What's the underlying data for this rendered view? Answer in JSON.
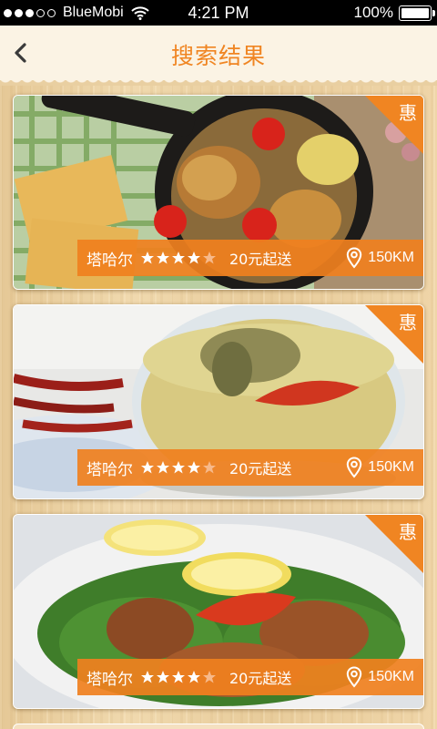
{
  "status_bar": {
    "carrier": "BlueMobi",
    "time": "4:21 PM",
    "battery": "100%"
  },
  "nav": {
    "title": "搜索结果",
    "back_icon": "chevron-left-icon"
  },
  "colors": {
    "accent": "#f08522",
    "nav_bg": "#fbf3e4"
  },
  "results": [
    {
      "badge": "惠",
      "name": "塔哈尔",
      "rating": 4,
      "rating_max": 5,
      "min_order": "20元起送",
      "distance": "150KM"
    },
    {
      "badge": "惠",
      "name": "塔哈尔",
      "rating": 4,
      "rating_max": 5,
      "min_order": "20元起送",
      "distance": "150KM"
    },
    {
      "badge": "惠",
      "name": "塔哈尔",
      "rating": 4,
      "rating_max": 5,
      "min_order": "20元起送",
      "distance": "150KM"
    }
  ]
}
